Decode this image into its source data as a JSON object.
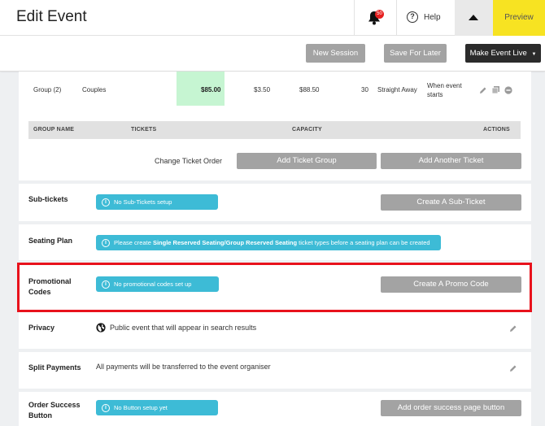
{
  "header": {
    "title": "Edit Event",
    "notification_count": "50",
    "help_label": "Help",
    "preview_label": "Preview"
  },
  "actions": {
    "new_session": "New Session",
    "save_later": "Save For Later",
    "make_live": "Make Event Live"
  },
  "ticket_row": {
    "group": "Group (2)",
    "name": "Couples",
    "price": "$85.00",
    "fee": "$3.50",
    "total": "$88.50",
    "capacity": "30",
    "release": "Straight Away",
    "ends": "When event starts"
  },
  "table_headers": [
    "GROUP NAME",
    "TICKETS",
    "CAPACITY",
    "ACTIONS"
  ],
  "ticket_actions": {
    "change_order": "Change Ticket Order",
    "add_group": "Add Ticket Group",
    "add_ticket": "Add Another Ticket"
  },
  "sections": {
    "subtickets": {
      "label": "Sub-tickets",
      "info": "No Sub-Tickets setup",
      "button": "Create A Sub-Ticket"
    },
    "seating": {
      "label": "Seating Plan",
      "info_pre": "Please create ",
      "info_bold": "Single Reserved Seating/Group Reserved Seating",
      "info_post": " ticket types before a seating plan can be created"
    },
    "promo": {
      "label": "Promotional Codes",
      "info": "No promotional codes set up",
      "button": "Create A Promo Code"
    },
    "privacy": {
      "label": "Privacy",
      "text": "Public event that will appear in search results"
    },
    "split": {
      "label": "Split Payments",
      "text": "All payments will be transferred to the event organiser"
    },
    "order_success": {
      "label": "Order Success Button",
      "info": "No Button setup yet",
      "button": "Add order success page button"
    }
  },
  "colors": {
    "accent_yellow": "#f7e322",
    "info_blue": "#3dbbd6",
    "button_grey": "#a3a3a3",
    "highlight_red": "#e8121c",
    "price_green": "#c6f5d2"
  }
}
